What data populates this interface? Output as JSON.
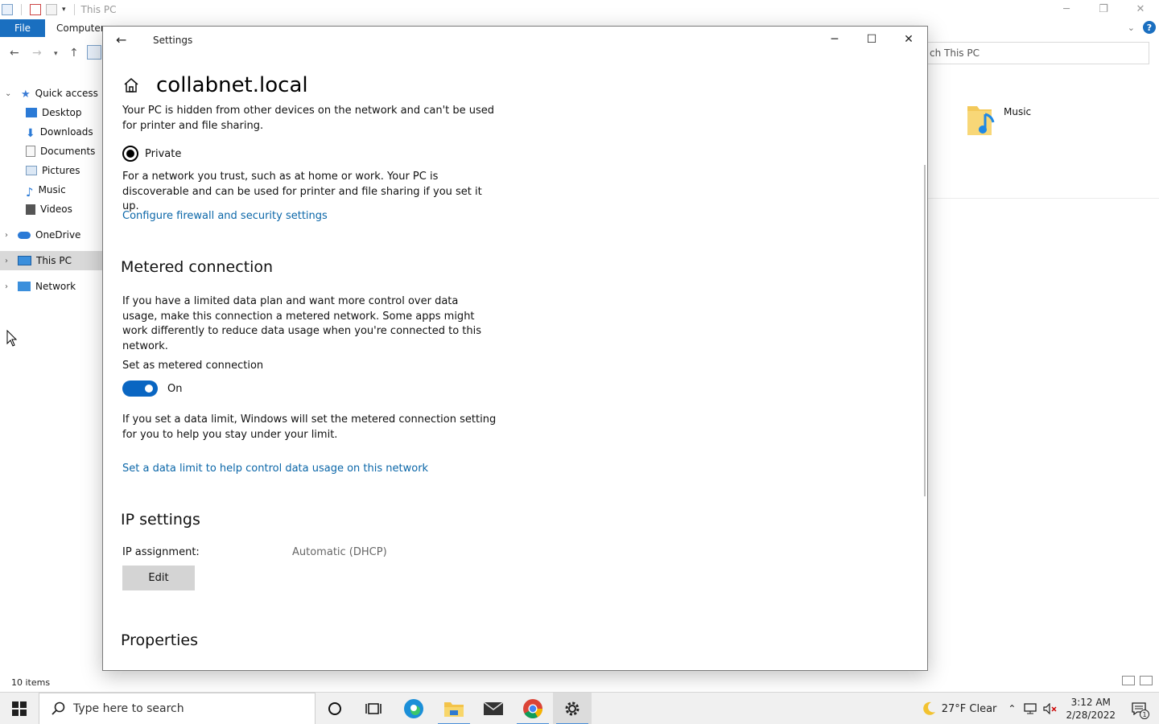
{
  "explorer": {
    "title": "This PC",
    "ribbon": {
      "file": "File",
      "computer": "Computer"
    },
    "search_text": "ch This PC",
    "sidebar": [
      {
        "label": "Quick access",
        "level": 0,
        "expanded": true
      },
      {
        "label": "Desktop",
        "level": 1
      },
      {
        "label": "Downloads",
        "level": 1
      },
      {
        "label": "Documents",
        "level": 1
      },
      {
        "label": "Pictures",
        "level": 1
      },
      {
        "label": "Music",
        "level": 1
      },
      {
        "label": "Videos",
        "level": 1
      },
      {
        "label": "OneDrive",
        "level": 0
      },
      {
        "label": "This PC",
        "level": 0,
        "active": true
      },
      {
        "label": "Network",
        "level": 0
      }
    ],
    "content_item": "Music",
    "status": "10 items"
  },
  "settings": {
    "window_title": "Settings",
    "page_title": "collabnet.local",
    "hidden_text": "Your PC is hidden from other devices on the network and can't be used for printer and file sharing.",
    "private_label": "Private",
    "private_desc": "For a network you trust, such as at home or work. Your PC is discoverable and can be used for printer and file sharing if you set it up.",
    "firewall_link": "Configure firewall and security settings",
    "metered_heading": "Metered connection",
    "metered_desc": "If you have a limited data plan and want more control over data usage, make this connection a metered network. Some apps might work differently to reduce data usage when you're connected to this network.",
    "metered_toggle_label": "Set as metered connection",
    "metered_toggle_state": "On",
    "limit_desc": "If you set a data limit, Windows will set the metered connection setting for you to help you stay under your limit.",
    "limit_link": "Set a data limit to help control data usage on this network",
    "ip_heading": "IP settings",
    "ip_label": "IP assignment:",
    "ip_value": "Automatic (DHCP)",
    "edit_label": "Edit",
    "properties_heading": "Properties"
  },
  "taskbar": {
    "search_placeholder": "Type here to search",
    "weather": "27°F  Clear",
    "time": "3:12 AM",
    "date": "2/28/2022",
    "notification_count": "1"
  },
  "colors": {
    "accent": "#0a66c2",
    "link": "#0a66a8",
    "file_tab": "#1a6fc0"
  }
}
